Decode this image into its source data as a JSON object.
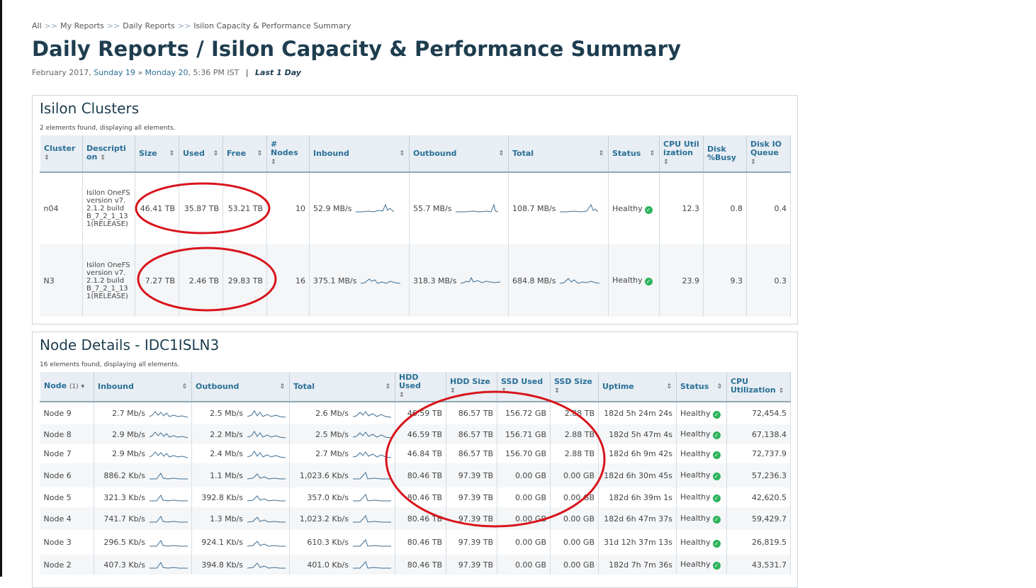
{
  "breadcrumb": [
    "All",
    "My Reports",
    "Daily Reports",
    "Isilon Capacity & Performance Summary"
  ],
  "breadcrumb_sep": ">>",
  "page_title": "Daily Reports / Isilon Capacity & Performance Summary",
  "dateline": {
    "month_year": "February 2017,",
    "start": "Sunday 19",
    "arrow": "»",
    "end": "Monday 20",
    "time": ", 5:36 PM IST",
    "sep": "|",
    "range": "Last 1 Day"
  },
  "clusters": {
    "title": "Isilon Clusters",
    "count_text": "2 elements found, displaying all elements.",
    "columns": [
      "Cluster",
      "Description",
      "Size",
      "Used",
      "Free",
      "# Nodes",
      "Inbound",
      "Outbound",
      "Total",
      "Status",
      "CPU Utilization",
      "Disk %Busy",
      "Disk IO Queue"
    ],
    "rows": [
      {
        "cluster": "n04",
        "description": "Isilon OneFS version v7.2.1.2 build B_7_2_1_131(RELEASE)",
        "size": "46.41 TB",
        "used": "35.87 TB",
        "free": "53.21 TB",
        "nodes": "10",
        "inbound": "52.9 MB/s",
        "outbound": "55.7 MB/s",
        "total": "108.7 MB/s",
        "status": "Healthy",
        "cpu": "12.3",
        "disk_busy": "0.8",
        "disk_queue": "0.4"
      },
      {
        "cluster": "N3",
        "description": "Isilon OneFS version v7.2.1.2 build B_7_2_1_131(RELEASE)",
        "size": "7.27 TB",
        "used": "2.46 TB",
        "free": "29.83 TB",
        "nodes": "16",
        "inbound": "375.1 MB/s",
        "outbound": "318.3 MB/s",
        "total": "684.8 MB/s",
        "status": "Healthy",
        "cpu": "23.9",
        "disk_busy": "9.3",
        "disk_queue": "0.3"
      }
    ]
  },
  "nodes": {
    "title": "Node Details - IDC1ISLN3",
    "count_text": "16 elements found, displaying all elements.",
    "columns": [
      "Node",
      "Inbound",
      "Outbound",
      "Total",
      "HDD Used",
      "HDD Size",
      "SSD Used",
      "SSD Size",
      "Uptime",
      "Status",
      "CPU Utilization"
    ],
    "sort_badge": "(1)",
    "rows": [
      {
        "node": "Node 9",
        "inbound": "2.7 Mb/s",
        "outbound": "2.5 Mb/s",
        "total": "2.6 Mb/s",
        "hdd_used": "46.59 TB",
        "hdd_size": "86.57 TB",
        "ssd_used": "156.72 GB",
        "ssd_size": "2.88 TB",
        "uptime": "182d 5h 24m 24s",
        "status": "Healthy",
        "cpu": "72,454.5"
      },
      {
        "node": "Node 8",
        "inbound": "2.9 Mb/s",
        "outbound": "2.2 Mb/s",
        "total": "2.5 Mb/s",
        "hdd_used": "46.59 TB",
        "hdd_size": "86.57 TB",
        "ssd_used": "156.71 GB",
        "ssd_size": "2.88 TB",
        "uptime": "182d 5h 47m 4s",
        "status": "Healthy",
        "cpu": "67,138.4"
      },
      {
        "node": "Node 7",
        "inbound": "2.9 Mb/s",
        "outbound": "2.4 Mb/s",
        "total": "2.7 Mb/s",
        "hdd_used": "46.84 TB",
        "hdd_size": "86.57 TB",
        "ssd_used": "156.70 GB",
        "ssd_size": "2.88 TB",
        "uptime": "182d 6h 9m 42s",
        "status": "Healthy",
        "cpu": "72,737.9"
      },
      {
        "node": "Node 6",
        "inbound": "886.2 Kb/s",
        "outbound": "1.1 Mb/s",
        "total": "1,023.6 Kb/s",
        "hdd_used": "80.46 TB",
        "hdd_size": "97.39 TB",
        "ssd_used": "0.00 GB",
        "ssd_size": "0.00 GB",
        "uptime": "182d 6h 30m 45s",
        "status": "Healthy",
        "cpu": "57,236.3"
      },
      {
        "node": "Node 5",
        "inbound": "321.3 Kb/s",
        "outbound": "392.8 Kb/s",
        "total": "357.0 Kb/s",
        "hdd_used": "80.46 TB",
        "hdd_size": "97.39 TB",
        "ssd_used": "0.00 GB",
        "ssd_size": "0.00 GB",
        "uptime": "182d 6h 39m 1s",
        "status": "Healthy",
        "cpu": "42,620.5"
      },
      {
        "node": "Node 4",
        "inbound": "741.7 Kb/s",
        "outbound": "1.3 Mb/s",
        "total": "1,023.2 Kb/s",
        "hdd_used": "80.46 TB",
        "hdd_size": "97.39 TB",
        "ssd_used": "0.00 GB",
        "ssd_size": "0.00 GB",
        "uptime": "182d 6h 47m 37s",
        "status": "Healthy",
        "cpu": "59,429.7"
      },
      {
        "node": "Node 3",
        "inbound": "296.5 Kb/s",
        "outbound": "924.1 Kb/s",
        "total": "610.3 Kb/s",
        "hdd_used": "80.46 TB",
        "hdd_size": "97.39 TB",
        "ssd_used": "0.00 GB",
        "ssd_size": "0.00 GB",
        "uptime": "31d 12h 37m 13s",
        "status": "Healthy",
        "cpu": "26,819.5"
      },
      {
        "node": "Node 2",
        "inbound": "407.3 Kb/s",
        "outbound": "394.8 Kb/s",
        "total": "401.0 Kb/s",
        "hdd_used": "80.46 TB",
        "hdd_size": "97.39 TB",
        "ssd_used": "0.00 GB",
        "ssd_size": "0.00 GB",
        "uptime": "182d 7h 7m 36s",
        "status": "Healthy",
        "cpu": "43,531.7"
      }
    ]
  },
  "icons": {
    "status_ok": "check-circle-icon",
    "sort": "sort-arrows-icon",
    "sparkline": "sparkline-icon"
  },
  "colors": {
    "title": "#1e3d4f",
    "link": "#2a6f97",
    "healthy": "#2db35c",
    "annotation": "#d8141c",
    "header_bg": "#e8eef3"
  }
}
